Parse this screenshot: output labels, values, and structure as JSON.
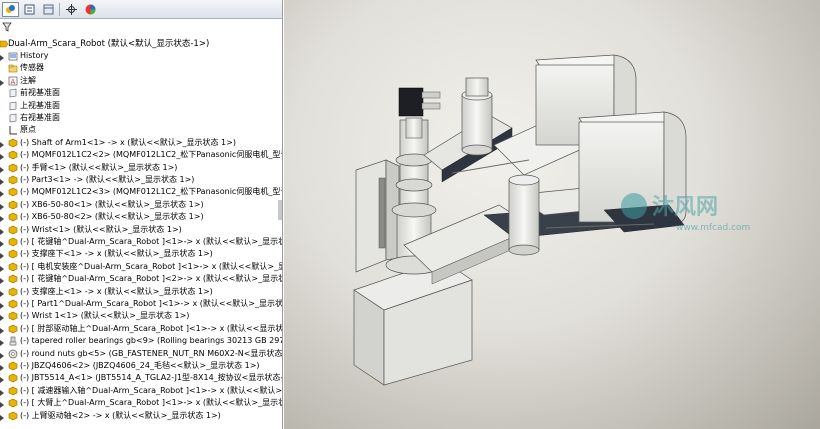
{
  "tree": {
    "root_label": "Dual-Arm_Scara_Robot  (默认<默认_显示状态-1>)",
    "items": [
      {
        "label": "History",
        "icon": "history-icon",
        "expander": true
      },
      {
        "label": "传感器",
        "icon": "sensors-folder-icon",
        "expander": false
      },
      {
        "label": "注解",
        "icon": "annotations-icon",
        "expander": true
      },
      {
        "label": "前视基准面",
        "icon": "plane-icon",
        "expander": false
      },
      {
        "label": "上视基准面",
        "icon": "plane-icon",
        "expander": false
      },
      {
        "label": "右视基准面",
        "icon": "plane-icon",
        "expander": false
      },
      {
        "label": "原点",
        "icon": "origin-icon",
        "expander": false
      },
      {
        "label": "(-) Shaft of Arm1<1> -> x (默认<<默认>_显示状态 1>)",
        "icon": "part-icon",
        "expander": true
      },
      {
        "label": "(-) MQMF012L1C2<2> (MQMF012L1C2_松下Panasonic伺服电机_型号",
        "icon": "part-icon",
        "expander": true
      },
      {
        "label": "(-) 手臂<1> (默认<<默认>_显示状态 1>)",
        "icon": "part-icon",
        "expander": true
      },
      {
        "label": "(-) Part3<1> -> (默认<<默认>_显示状态 1>)",
        "icon": "part-icon",
        "expander": true
      },
      {
        "label": "(-) MQMF012L1C2<3> (MQMF012L1C2_松下Panasonic伺服电机_型号",
        "icon": "part-icon",
        "expander": true
      },
      {
        "label": "(-) XB6-50-80<1> (默认<<默认>_显示状态 1>)",
        "icon": "part-icon",
        "expander": true
      },
      {
        "label": "(-) XB6-50-80<2> (默认<<默认>_显示状态 1>)",
        "icon": "part-icon",
        "expander": true
      },
      {
        "label": "(-) Wrist<1> (默认<<默认>_显示状态 1>)",
        "icon": "part-icon",
        "expander": true
      },
      {
        "label": "(-) [ 花键轴^Dual-Arm_Scara_Robot ]<1>-> x (默认<<默认>_显示状",
        "icon": "part-icon",
        "expander": true
      },
      {
        "label": "(-) 支撑座下<1> -> x (默认<<默认>_显示状态 1>)",
        "icon": "part-icon",
        "expander": true
      },
      {
        "label": "(-) [ 电机安装座^Dual-Arm_Scara_Robot ]<1>-> x (默认<<默认>_显示",
        "icon": "part-icon",
        "expander": true
      },
      {
        "label": "(-) [ 花键轴^Dual-Arm_Scara_Robot ]<2>-> x (默认<<默认>_显示状",
        "icon": "part-icon",
        "expander": true
      },
      {
        "label": "(-) 支撑座上<1> -> x (默认<<默认>_显示状态 1>)",
        "icon": "part-icon",
        "expander": true
      },
      {
        "label": "(-) [ Part1^Dual-Arm_Scara_Robot ]<1>-> x (默认<<默认>_显示状态",
        "icon": "part-icon",
        "expander": true
      },
      {
        "label": "(-) Wrist 1<1> (默认<<默认>_显示状态 1>)",
        "icon": "part-icon",
        "expander": true
      },
      {
        "label": "(-) [ 肘部驱动轴上^Dual-Arm_Scara_Robot ]<1>-> x (默认<<显示状态",
        "icon": "part-icon",
        "expander": true
      },
      {
        "label": "(-) tapered roller bearings gb<9> (Rolling bearings 30213 GB 297-9",
        "icon": "bearing-icon",
        "expander": true
      },
      {
        "label": "(-) round nuts gb<5> (GB_FASTENER_NUT_RN M60X2-N<显示状态-8",
        "icon": "nut-icon",
        "expander": true
      },
      {
        "label": "(-) JBZQ4606<2> (JBZQ4606_24_毛毡<<默认>_显示状态 1>)",
        "icon": "part-icon",
        "expander": true
      },
      {
        "label": "(-) JBT5514_A<1> (JBT5514_A_TGLA2-J1型-8X14_按协议<显示状态-2",
        "icon": "part-icon",
        "expander": true
      },
      {
        "label": "(-) [ 减速器输入轴^Dual-Arm_Scara_Robot ]<1>-> x (默认<<默认>_显",
        "icon": "part-icon",
        "expander": true
      },
      {
        "label": "(-) [ 大臂上^Dual-Arm_Scara_Robot ]<1>-> x (默认<<默认>_显示状态",
        "icon": "part-icon",
        "expander": true
      },
      {
        "label": "(-) 上臂驱动轴<2> -> x (默认<<默认>_显示状态 1>)",
        "icon": "part-icon",
        "expander": true
      }
    ]
  },
  "toolbar_icons": [
    "feature-manager-tab-icon",
    "property-manager-tab-icon",
    "configuration-manager-tab-icon",
    "dimxpert-tab-icon",
    "display-manager-tab-icon"
  ],
  "filter_icon": "filter-icon",
  "watermark": {
    "logo": "沐风网",
    "url": "www.mfcad.com"
  },
  "colors": {
    "part_icon": "#e8b400",
    "view_bg": "#d9d6ce",
    "robot_metal": "#e9e9e6",
    "robot_dark": "#2f3540"
  }
}
